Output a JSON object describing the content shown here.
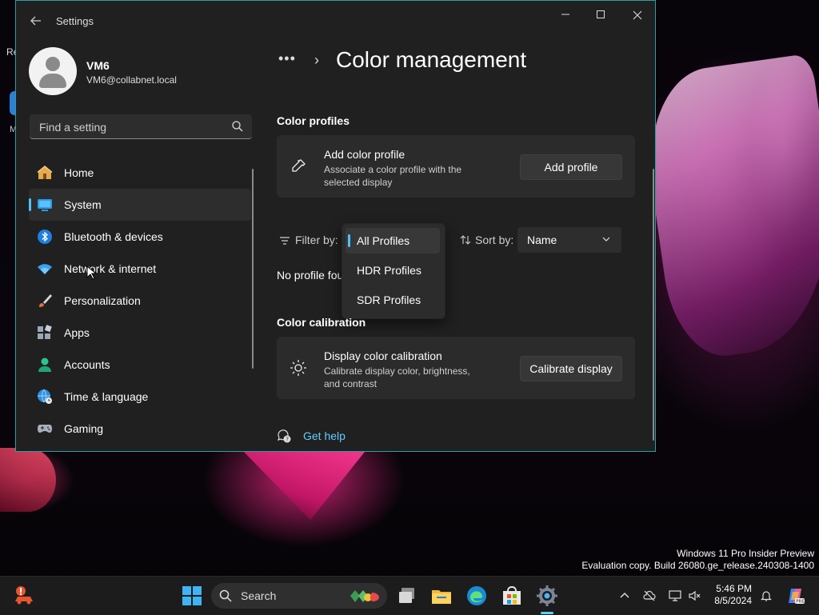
{
  "desktop": {
    "label_fragment": "Re",
    "label_fragment2": "M",
    "watermark_line1": "Windows 11 Pro Insider Preview",
    "watermark_line2": "Evaluation copy. Build 26080.ge_release.240308-1400"
  },
  "window": {
    "title": "Settings",
    "minimize_icon": "minimize-icon",
    "maximize_icon": "maximize-icon",
    "close_icon": "close-icon"
  },
  "user": {
    "name": "VM6",
    "email": "VM6@collabnet.local"
  },
  "search": {
    "placeholder": "Find a setting"
  },
  "sidebar": {
    "items": [
      {
        "label": "Home",
        "icon": "home-icon"
      },
      {
        "label": "System",
        "icon": "system-icon",
        "active": true
      },
      {
        "label": "Bluetooth & devices",
        "icon": "bluetooth-icon"
      },
      {
        "label": "Network & internet",
        "icon": "wifi-icon"
      },
      {
        "label": "Personalization",
        "icon": "brush-icon"
      },
      {
        "label": "Apps",
        "icon": "apps-icon"
      },
      {
        "label": "Accounts",
        "icon": "accounts-icon"
      },
      {
        "label": "Time & language",
        "icon": "globe-clock-icon"
      },
      {
        "label": "Gaming",
        "icon": "gamepad-icon"
      }
    ]
  },
  "main": {
    "breadcrumb_more": "•••",
    "breadcrumb_chevron": "›",
    "title": "Color management",
    "color_profiles": {
      "section_title": "Color profiles",
      "card_title": "Add color profile",
      "card_desc": "Associate a color profile with the selected display",
      "button": "Add profile"
    },
    "filter": {
      "label": "Filter by:",
      "options": [
        "All Profiles",
        "HDR Profiles",
        "SDR Profiles"
      ],
      "selected": "All Profiles"
    },
    "sort": {
      "label": "Sort by:",
      "value": "Name"
    },
    "no_profiles_text": "No profile fou",
    "calibration": {
      "section_title": "Color calibration",
      "card_title": "Display color calibration",
      "card_desc": "Calibrate display color, brightness, and contrast",
      "button": "Calibrate display"
    },
    "help_link": "Get help"
  },
  "taskbar": {
    "search_label": "Search",
    "time": "5:46 PM",
    "date": "8/5/2024",
    "accent": "#60cdff"
  }
}
